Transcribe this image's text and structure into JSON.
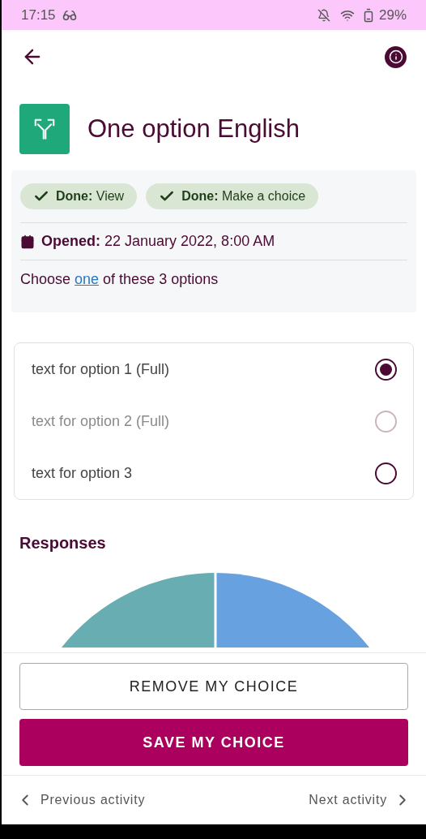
{
  "status_bar": {
    "time": "17:15",
    "battery": "29%"
  },
  "activity": {
    "title": "One option English"
  },
  "completion": [
    {
      "text": "**Done:** View"
    },
    {
      "text": "**Done:** Make a choice"
    }
  ],
  "opened": "**Opened:** 22 January 2022, 8:00 AM",
  "instruction": {
    "before": "Choose ",
    "link": "one",
    "after": " of these 3 options"
  },
  "options": [
    {
      "label": "text for option 1 (Full)",
      "selected": true,
      "disabled": false
    },
    {
      "label": "text for option 2 (Full)",
      "selected": false,
      "disabled": true
    },
    {
      "label": "text for option 3",
      "selected": false,
      "disabled": false
    }
  ],
  "responses": {
    "title": "Responses"
  },
  "buttons": [
    {
      "label": "REMOVE MY CHOICE",
      "kind": "outline"
    },
    {
      "label": "SAVE MY CHOICE",
      "kind": "filled"
    }
  ],
  "navigation": {
    "previous": "Previous activity",
    "next": "Next activity"
  }
}
